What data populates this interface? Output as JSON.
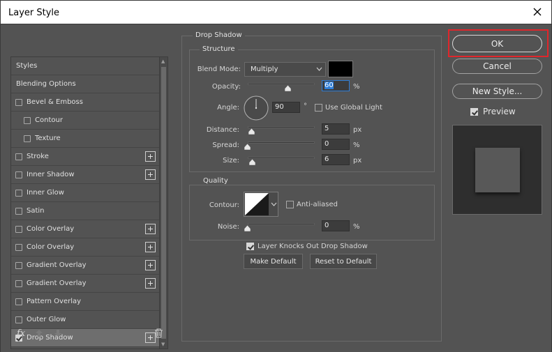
{
  "window": {
    "title": "Layer Style"
  },
  "styles_list": {
    "items": [
      {
        "label": "Styles",
        "checkbox": false,
        "checked": false,
        "plus": false,
        "sub": false
      },
      {
        "label": "Blending Options",
        "checkbox": false,
        "checked": false,
        "plus": false,
        "sub": false
      },
      {
        "label": "Bevel & Emboss",
        "checkbox": true,
        "checked": false,
        "plus": false,
        "sub": false
      },
      {
        "label": "Contour",
        "checkbox": true,
        "checked": false,
        "plus": false,
        "sub": true
      },
      {
        "label": "Texture",
        "checkbox": true,
        "checked": false,
        "plus": false,
        "sub": true
      },
      {
        "label": "Stroke",
        "checkbox": true,
        "checked": false,
        "plus": true,
        "sub": false
      },
      {
        "label": "Inner Shadow",
        "checkbox": true,
        "checked": false,
        "plus": true,
        "sub": false
      },
      {
        "label": "Inner Glow",
        "checkbox": true,
        "checked": false,
        "plus": false,
        "sub": false
      },
      {
        "label": "Satin",
        "checkbox": true,
        "checked": false,
        "plus": false,
        "sub": false
      },
      {
        "label": "Color Overlay",
        "checkbox": true,
        "checked": false,
        "plus": true,
        "sub": false
      },
      {
        "label": "Color Overlay",
        "checkbox": true,
        "checked": false,
        "plus": true,
        "sub": false
      },
      {
        "label": "Gradient Overlay",
        "checkbox": true,
        "checked": false,
        "plus": true,
        "sub": false
      },
      {
        "label": "Gradient Overlay",
        "checkbox": true,
        "checked": false,
        "plus": true,
        "sub": false
      },
      {
        "label": "Pattern Overlay",
        "checkbox": true,
        "checked": false,
        "plus": false,
        "sub": false
      },
      {
        "label": "Outer Glow",
        "checkbox": true,
        "checked": false,
        "plus": false,
        "sub": false
      },
      {
        "label": "Drop Shadow",
        "checkbox": true,
        "checked": true,
        "plus": true,
        "sub": false,
        "selected": true
      }
    ],
    "footer_fx": "fx"
  },
  "drop_shadow": {
    "group_title": "Drop Shadow",
    "structure": {
      "title": "Structure",
      "blend_mode_label": "Blend Mode:",
      "blend_mode_value": "Multiply",
      "shadow_color": "#000000",
      "opacity_label": "Opacity:",
      "opacity_value": "60",
      "opacity_unit": "%",
      "angle_label": "Angle:",
      "angle_value": "90",
      "angle_unit": "°",
      "use_global_light_label": "Use Global Light",
      "use_global_light_checked": false,
      "distance_label": "Distance:",
      "distance_value": "5",
      "distance_unit": "px",
      "spread_label": "Spread:",
      "spread_value": "0",
      "spread_unit": "%",
      "size_label": "Size:",
      "size_value": "6",
      "size_unit": "px"
    },
    "quality": {
      "title": "Quality",
      "contour_label": "Contour:",
      "anti_aliased_label": "Anti-aliased",
      "anti_aliased_checked": false,
      "noise_label": "Noise:",
      "noise_value": "0",
      "noise_unit": "%"
    },
    "layer_knocks_out_label": "Layer Knocks Out Drop Shadow",
    "layer_knocks_out_checked": true,
    "make_default_label": "Make Default",
    "reset_to_default_label": "Reset to Default"
  },
  "actions": {
    "ok_label": "OK",
    "cancel_label": "Cancel",
    "new_style_label": "New Style...",
    "preview_label": "Preview",
    "preview_checked": true,
    "highlight_color": "#e0262b"
  }
}
